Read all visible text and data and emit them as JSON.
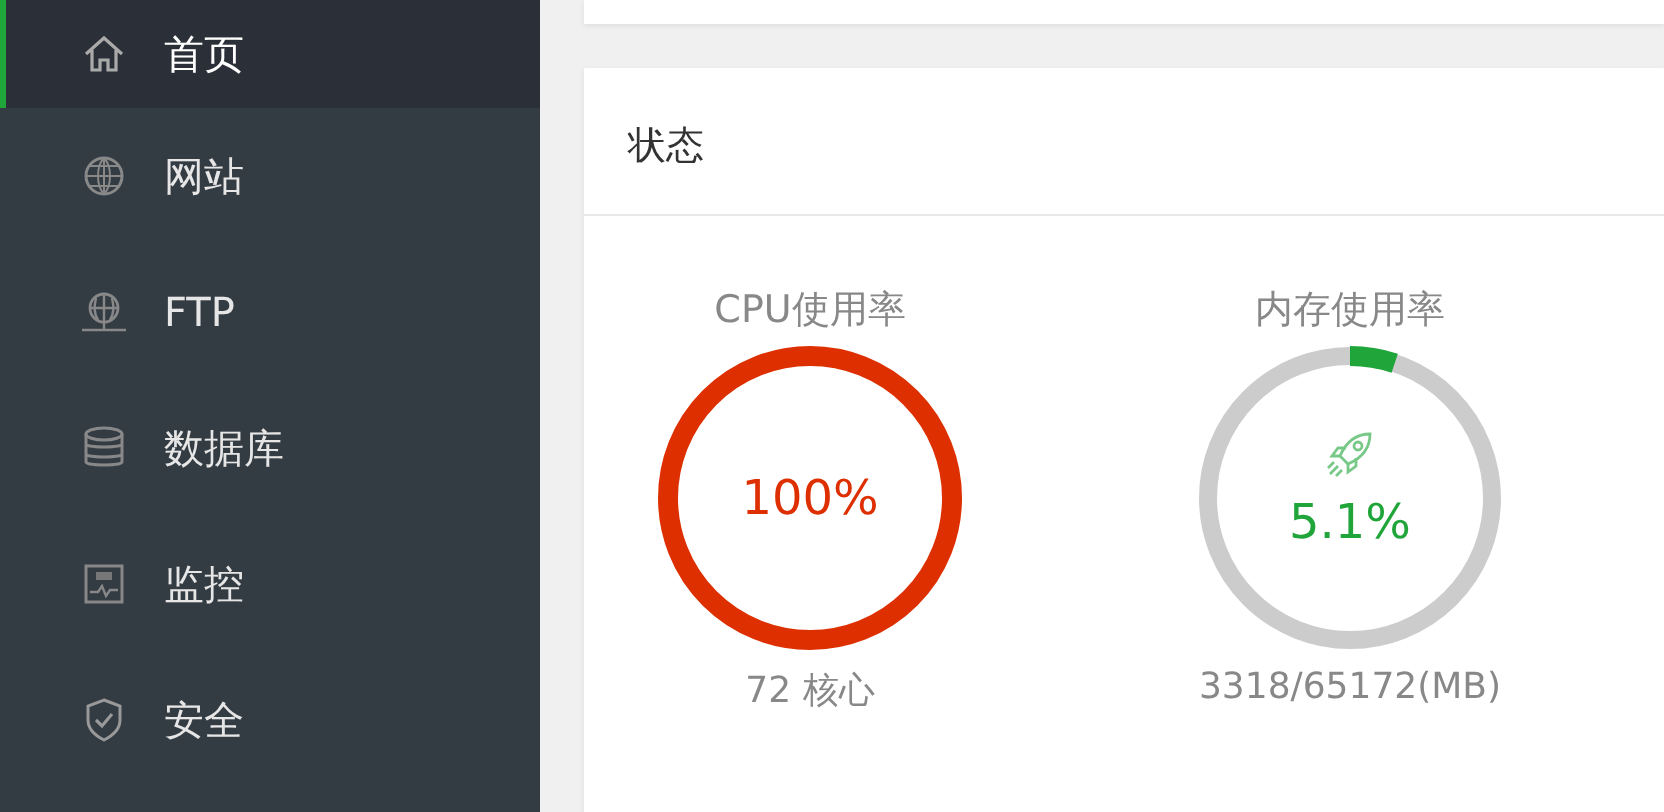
{
  "sidebar": {
    "items": [
      {
        "label": "首页",
        "kind": "home",
        "selected": true
      },
      {
        "label": "网站",
        "kind": "globe",
        "selected": false
      },
      {
        "label": "FTP",
        "kind": "ftp",
        "selected": false
      },
      {
        "label": "数据库",
        "kind": "database",
        "selected": false
      },
      {
        "label": "监控",
        "kind": "monitor",
        "selected": false
      },
      {
        "label": "安全",
        "kind": "shield",
        "selected": false
      }
    ]
  },
  "status_panel": {
    "title": "状态",
    "gauges": [
      {
        "title": "CPU使用率",
        "value": "100%",
        "level": 1.0,
        "color": "#dd2f00",
        "kind": "plain",
        "detail": "72 核心"
      },
      {
        "title": "内存使用率",
        "value": "5.1%",
        "level": 0.051,
        "color": "#20a53a",
        "kind": "rocket",
        "detail": "3318/65172(MB)"
      }
    ]
  }
}
